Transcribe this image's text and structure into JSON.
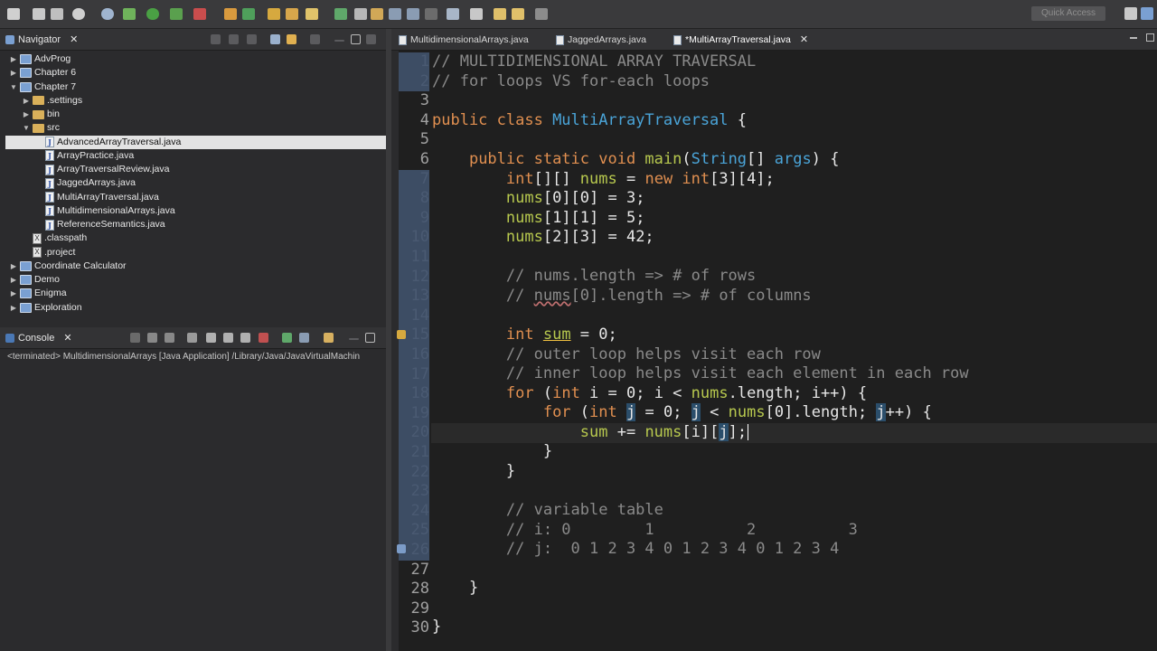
{
  "toolbar": {
    "quick_access_placeholder": "Quick Access"
  },
  "navigator": {
    "tab_label": "Navigator",
    "tree": [
      {
        "label": "AdvProg",
        "type": "project",
        "level": 0,
        "expanded": false
      },
      {
        "label": "Chapter 6",
        "type": "project",
        "level": 0,
        "expanded": false
      },
      {
        "label": "Chapter 7",
        "type": "project",
        "level": 0,
        "expanded": true
      },
      {
        "label": ".settings",
        "type": "folder",
        "level": 1,
        "expanded": false
      },
      {
        "label": "bin",
        "type": "folder",
        "level": 1,
        "expanded": false
      },
      {
        "label": "src",
        "type": "folder",
        "level": 1,
        "expanded": true
      },
      {
        "label": "AdvancedArrayTraversal.java",
        "type": "java",
        "level": 2,
        "selected": true
      },
      {
        "label": "ArrayPractice.java",
        "type": "java",
        "level": 2
      },
      {
        "label": "ArrayTraversalReview.java",
        "type": "java",
        "level": 2
      },
      {
        "label": "JaggedArrays.java",
        "type": "java",
        "level": 2
      },
      {
        "label": "MultiArrayTraversal.java",
        "type": "java",
        "level": 2
      },
      {
        "label": "MultidimensionalArrays.java",
        "type": "java",
        "level": 2
      },
      {
        "label": "ReferenceSemantics.java",
        "type": "java",
        "level": 2
      },
      {
        "label": ".classpath",
        "type": "xml",
        "level": 1
      },
      {
        "label": ".project",
        "type": "xml",
        "level": 1
      },
      {
        "label": "Coordinate Calculator",
        "type": "project",
        "level": 0,
        "expanded": false
      },
      {
        "label": "Demo",
        "type": "project",
        "level": 0,
        "expanded": false
      },
      {
        "label": "Enigma",
        "type": "project",
        "level": 0,
        "expanded": false
      },
      {
        "label": "Exploration",
        "type": "project",
        "level": 0,
        "expanded": false
      }
    ]
  },
  "console": {
    "tab_label": "Console",
    "status_line": "<terminated> MultidimensionalArrays [Java Application] /Library/Java/JavaVirtualMachin"
  },
  "editor": {
    "tabs": [
      {
        "label": "MultidimensionalArrays.java",
        "active": false
      },
      {
        "label": "JaggedArrays.java",
        "active": false
      },
      {
        "label": "*MultiArrayTraversal.java",
        "active": true
      }
    ],
    "line_numbers": [
      "1",
      "2",
      "3",
      "4",
      "5",
      "6",
      "7",
      "8",
      "9",
      "10",
      "11",
      "12",
      "13",
      "14",
      "15",
      "16",
      "17",
      "18",
      "19",
      "20",
      "21",
      "22",
      "23",
      "24",
      "25",
      "26",
      "27",
      "28",
      "29",
      "30"
    ],
    "current_line": 20
  },
  "colors": {
    "keyword": "#e08f50",
    "type": "#4aa4d8",
    "comment": "#8a8a8a",
    "selection": "#2b4e6b"
  }
}
